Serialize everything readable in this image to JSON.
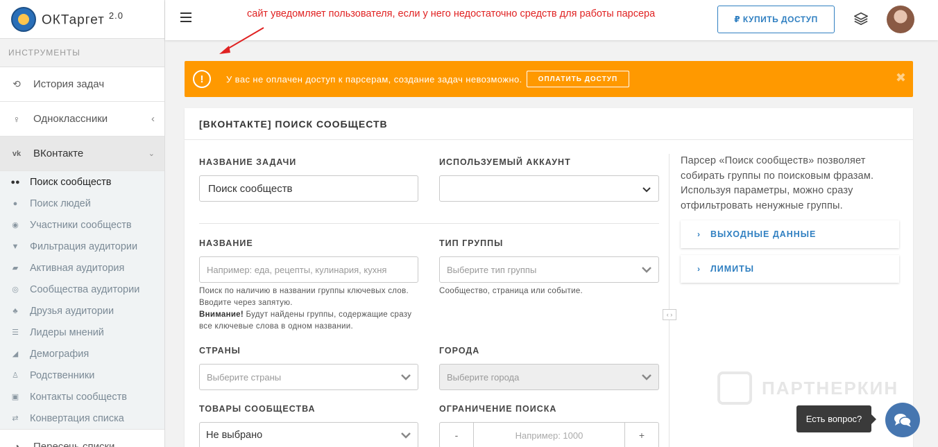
{
  "brand": {
    "name": "ОКТаргет",
    "version": "2.0"
  },
  "sidebar": {
    "section_title": "ИНСТРУМЕНТЫ",
    "items": [
      {
        "label": "История задач",
        "icon": "history-icon"
      },
      {
        "label": "Одноклассники",
        "icon": "odnoklassniki-icon"
      },
      {
        "label": "ВКонтакте",
        "icon": "vk-icon"
      }
    ],
    "vk_sub": [
      {
        "label": "Поиск сообществ",
        "icon": "users-icon"
      },
      {
        "label": "Поиск людей",
        "icon": "user-icon"
      },
      {
        "label": "Участники сообществ",
        "icon": "user-circle-icon"
      },
      {
        "label": "Фильтрация аудитории",
        "icon": "filter-icon"
      },
      {
        "label": "Активная аудитория",
        "icon": "comments-icon"
      },
      {
        "label": "Сообщества аудитории",
        "icon": "podcast-icon"
      },
      {
        "label": "Друзья аудитории",
        "icon": "friends-icon"
      },
      {
        "label": "Лидеры мнений",
        "icon": "leaders-icon"
      },
      {
        "label": "Демография",
        "icon": "area-chart-icon"
      },
      {
        "label": "Родственники",
        "icon": "person-icon"
      },
      {
        "label": "Контакты сообществ",
        "icon": "contact-card-icon"
      },
      {
        "label": "Конвертация списка",
        "icon": "exchange-icon"
      }
    ],
    "next_item": {
      "label": "Пересечь списки",
      "icon": "pie-icon"
    }
  },
  "topbar": {
    "annotation": "сайт уведомляет пользователя, если у него недостаточно средств для работы парсера",
    "buy_label": "₽ КУПИТЬ ДОСТУП"
  },
  "alert": {
    "text": "У вас не оплачен доступ к парсерам, создание задач невозможно.",
    "button": "ОПЛАТИТЬ ДОСТУП"
  },
  "card": {
    "title": "[ВКОНТАКТЕ] ПОИСК СООБЩЕСТВ",
    "task_name": {
      "label": "НАЗВАНИЕ ЗАДАЧИ",
      "value": "Поиск сообществ"
    },
    "account": {
      "label": "ИСПОЛЬЗУЕМЫЙ АККАУНТ",
      "value": ""
    },
    "name": {
      "label": "НАЗВАНИЕ",
      "placeholder": "Например: еда, рецепты, кулинария, кухня",
      "help1": "Поиск по наличию в названии группы ключевых слов. Вводите через запятую.",
      "help_bold": "Внимание!",
      "help2": " Будут найдены группы, содержащие сразу все ключевые слова в одном названии."
    },
    "group_type": {
      "label": "ТИП ГРУППЫ",
      "placeholder": "Выберите тип группы",
      "help": "Сообщество, страница или событие."
    },
    "countries": {
      "label": "СТРАНЫ",
      "placeholder": "Выберите страны"
    },
    "cities": {
      "label": "ГОРОДА",
      "placeholder": "Выберите города"
    },
    "goods": {
      "label": "ТОВАРЫ СООБЩЕСТВА",
      "value": "Не выбрано"
    },
    "limit": {
      "label": "ОГРАНИЧЕНИЕ ПОИСКА",
      "placeholder": "Например: 1000",
      "minus": "-",
      "plus": "+"
    },
    "description": "Парсер «Поиск сообществ» позволяет собирать группы по поисковым фразам. Используя параметры, можно сразу отфильтровать ненужные группы.",
    "accordion": [
      {
        "label": "ВЫХОДНЫЕ ДАННЫЕ"
      },
      {
        "label": "ЛИМИТЫ"
      }
    ]
  },
  "watermark": "ПАРТНЕРКИН",
  "chat": {
    "tooltip": "Есть вопрос?"
  },
  "colors": {
    "accent": "#2f7fc1",
    "alert": "#ff9900",
    "annotation": "#e02222",
    "chat": "#4676b0"
  }
}
